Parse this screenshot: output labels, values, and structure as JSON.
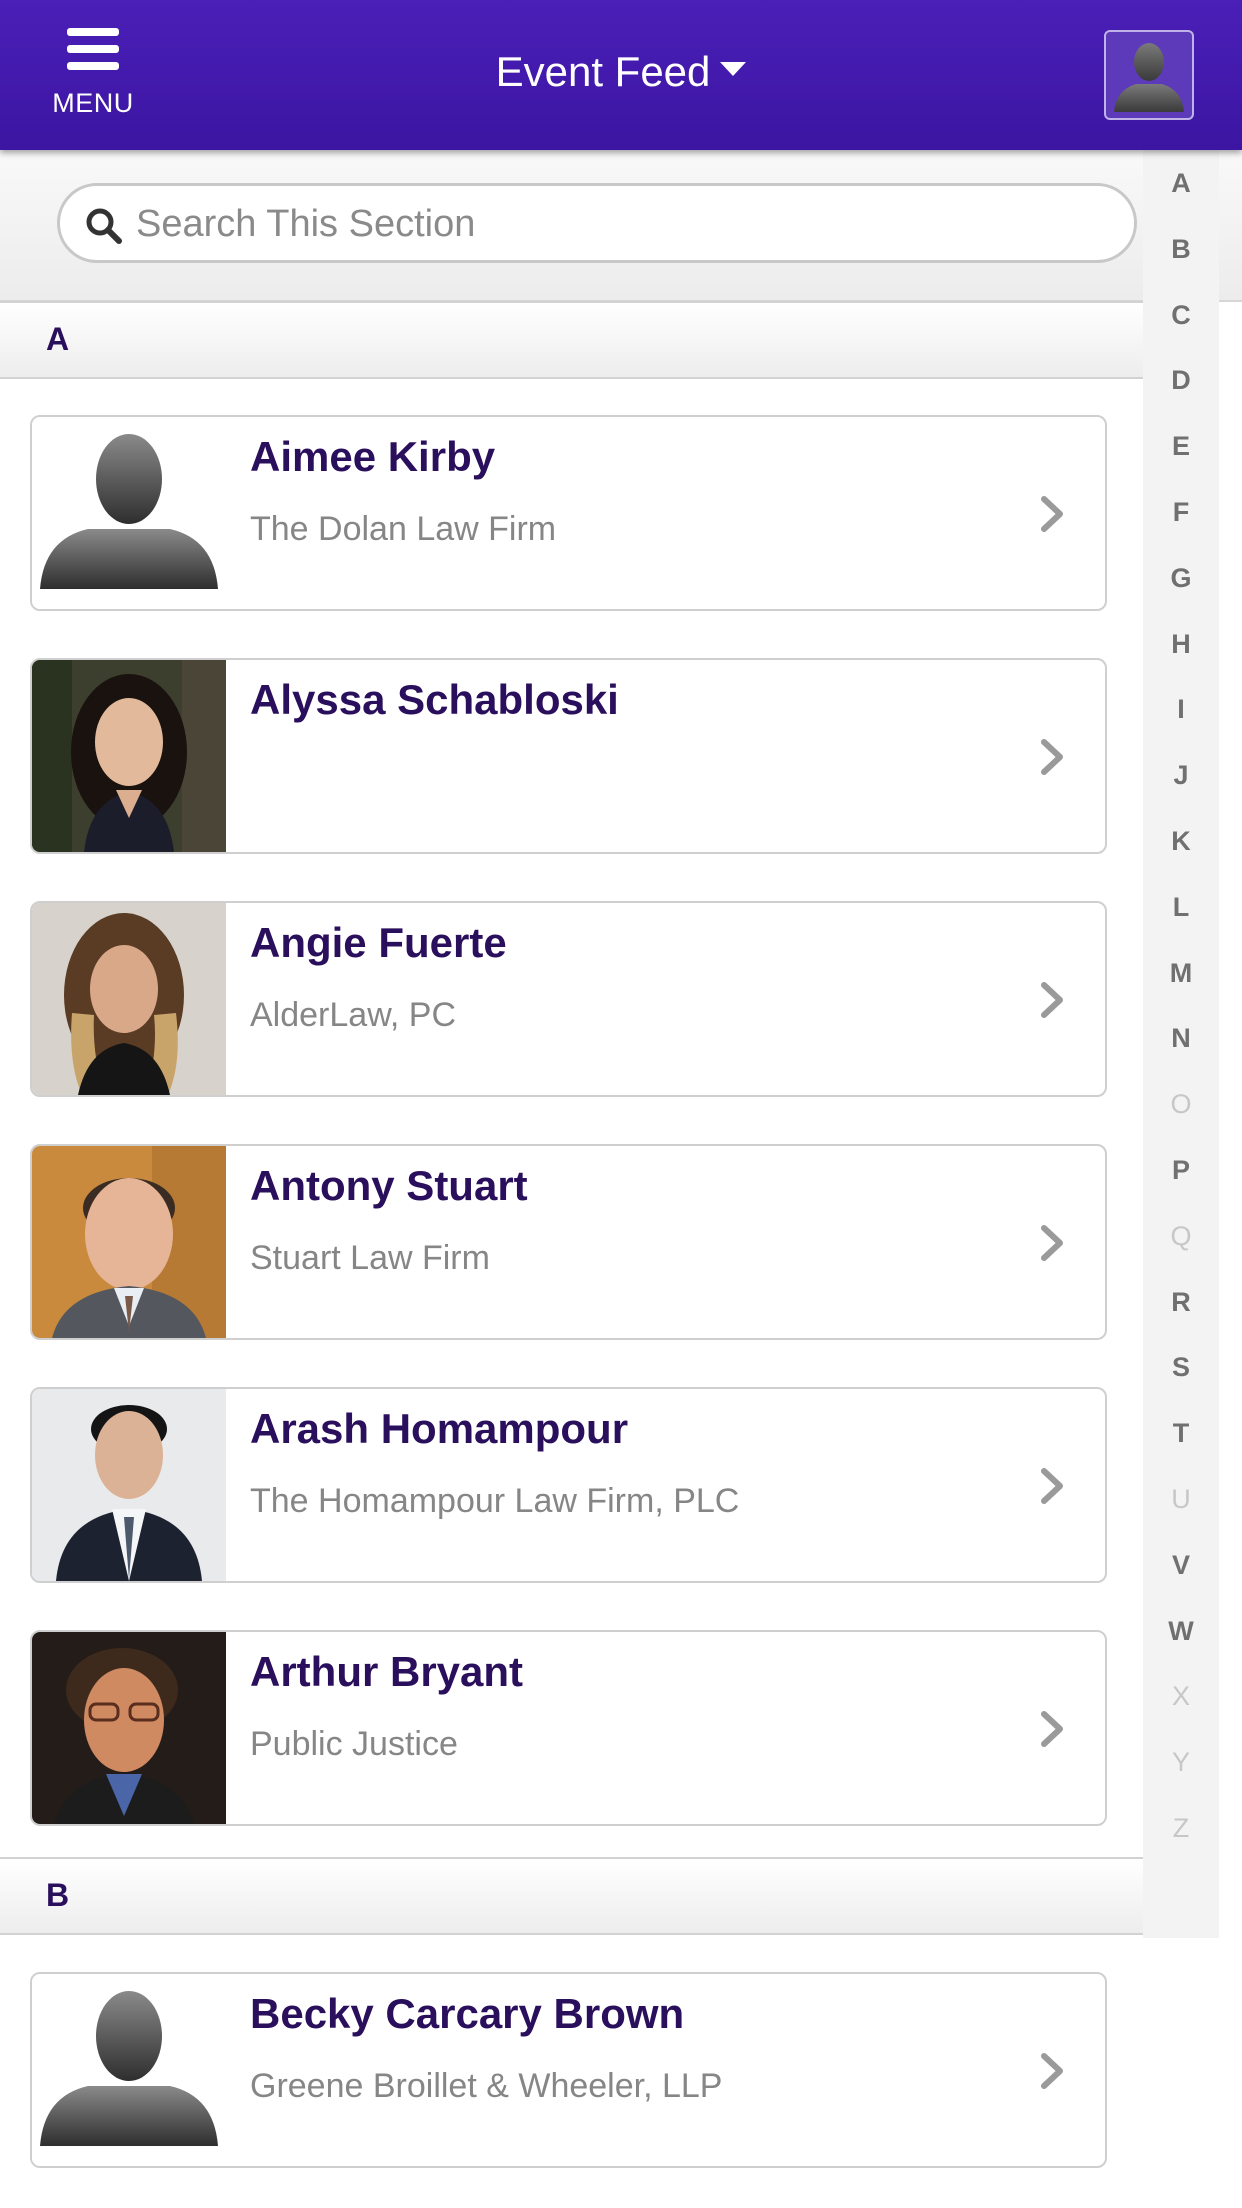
{
  "header": {
    "menu_label": "MENU",
    "title": "Event Feed"
  },
  "search": {
    "placeholder": "Search This Section"
  },
  "alphabet": {
    "active": [
      "A",
      "B",
      "C",
      "D",
      "E",
      "F",
      "G",
      "H",
      "I",
      "J",
      "K",
      "L",
      "M",
      "N",
      "P",
      "R",
      "S",
      "T",
      "V",
      "W"
    ],
    "all": [
      "A",
      "B",
      "C",
      "D",
      "E",
      "F",
      "G",
      "H",
      "I",
      "J",
      "K",
      "L",
      "M",
      "N",
      "O",
      "P",
      "Q",
      "R",
      "S",
      "T",
      "U",
      "V",
      "W",
      "X",
      "Y",
      "Z"
    ]
  },
  "sections": [
    {
      "letter": "A",
      "people": [
        {
          "name": "Aimee Kirby",
          "firm": "The Dolan Law Firm",
          "photo": "placeholder-silhouette"
        },
        {
          "name": "Alyssa Schabloski",
          "firm": "",
          "photo": "portrait"
        },
        {
          "name": "Angie Fuerte",
          "firm": "AlderLaw, PC",
          "photo": "portrait"
        },
        {
          "name": "Antony Stuart",
          "firm": "Stuart Law Firm",
          "photo": "portrait"
        },
        {
          "name": "Arash Homampour",
          "firm": "The Homampour Law Firm, PLC",
          "photo": "portrait"
        },
        {
          "name": "Arthur Bryant",
          "firm": "Public Justice",
          "photo": "portrait"
        }
      ]
    },
    {
      "letter": "B",
      "people": [
        {
          "name": "Becky Carcary Brown",
          "firm": "Greene Broillet & Wheeler, LLP",
          "photo": "placeholder-silhouette"
        }
      ]
    }
  ],
  "colors": {
    "header_bg": "#4a1fb8",
    "name_text": "#2a0f5c",
    "firm_text": "#868686"
  },
  "icons": {
    "menu": "hamburger-icon",
    "title_dropdown": "caret-down-icon",
    "profile": "user-silhouette-icon",
    "search": "search-icon",
    "row_action": "chevron-right-icon"
  }
}
